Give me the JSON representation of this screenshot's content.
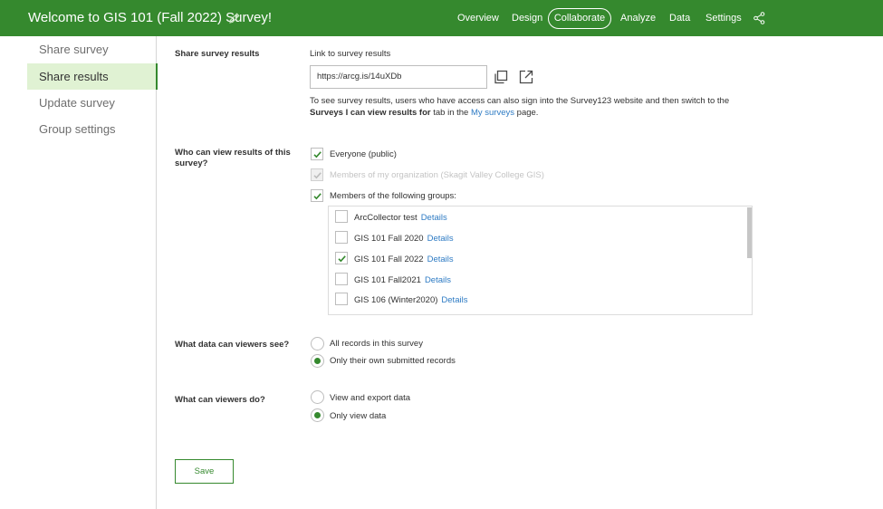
{
  "header": {
    "title": "Welcome to GIS 101 (Fall 2022) Survey!",
    "nav": [
      "Overview",
      "Design",
      "Collaborate",
      "Analyze",
      "Data",
      "Settings"
    ],
    "active_nav": "Collaborate",
    "colors": {
      "brand": "#35892e",
      "link": "#2e7bc4"
    }
  },
  "sidebar": {
    "items": [
      {
        "label": "Share survey"
      },
      {
        "label": "Share results"
      },
      {
        "label": "Update survey"
      },
      {
        "label": "Group settings"
      }
    ],
    "active": "Share results"
  },
  "share_results": {
    "section_label": "Share survey results",
    "field_label": "Link to survey results",
    "url": "https://arcg.is/14uXDb",
    "help_part1": "To see survey results, users who have access can also sign into the Survey123 website and then switch to the ",
    "help_bold": "Surveys I can view results for",
    "help_part2": " tab in the ",
    "help_link": "My surveys",
    "help_part3": " page."
  },
  "who_can_view": {
    "label": "Who can view results of this survey?",
    "options": [
      {
        "label": "Everyone (public)",
        "checked": true,
        "disabled": false
      },
      {
        "label": "Members of my organization (Skagit Valley College GIS)",
        "checked": true,
        "disabled": true
      },
      {
        "label": "Members of the following groups:",
        "checked": true,
        "disabled": false
      }
    ],
    "groups": [
      {
        "name": "ArcCollector test",
        "details": "Details",
        "checked": false
      },
      {
        "name": "GIS 101 Fall 2020",
        "details": "Details",
        "checked": false
      },
      {
        "name": "GIS 101 Fall 2022",
        "details": "Details",
        "checked": true
      },
      {
        "name": "GIS 101 Fall2021",
        "details": "Details",
        "checked": false
      },
      {
        "name": "GIS 106 (Winter2020)",
        "details": "Details",
        "checked": false
      }
    ]
  },
  "what_data": {
    "label": "What data can viewers see?",
    "options": [
      {
        "label": "All records in this survey",
        "selected": false
      },
      {
        "label": "Only their own submitted records",
        "selected": true
      }
    ]
  },
  "what_do": {
    "label": "What can viewers do?",
    "options": [
      {
        "label": "View and export data",
        "selected": false
      },
      {
        "label": "Only view data",
        "selected": true
      }
    ]
  },
  "save_label": "Save"
}
